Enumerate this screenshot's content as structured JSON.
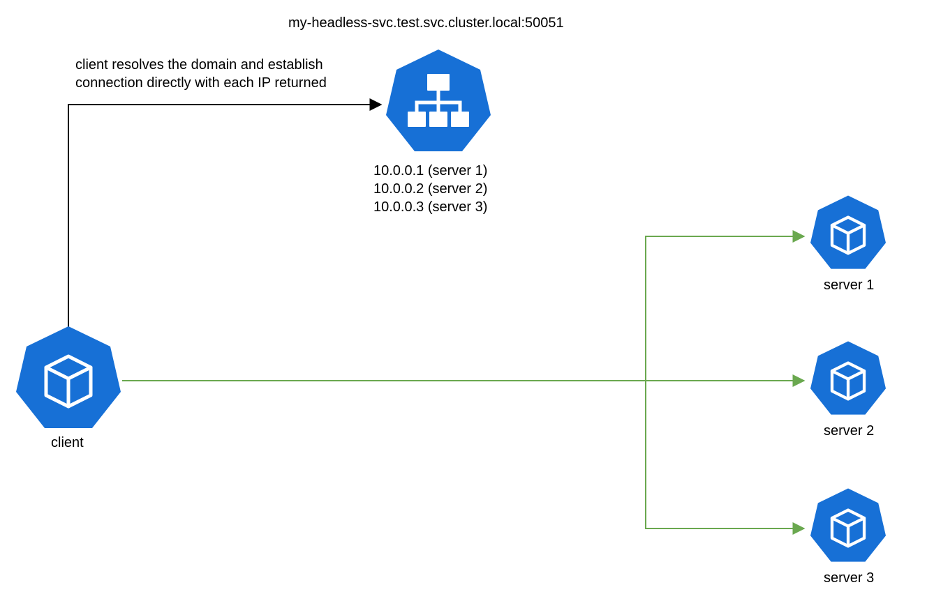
{
  "title": "my-headless-svc.test.svc.cluster.local:50051",
  "annotation": "client resolves the domain and establish\nconnection directly with each IP returned",
  "dns_results": [
    "10.0.0.1 (server 1)",
    "10.0.0.2 (server 2)",
    "10.0.0.3 (server 3)"
  ],
  "nodes": {
    "client": {
      "label": "client"
    },
    "server1": {
      "label": "server 1"
    },
    "server2": {
      "label": "server 2"
    },
    "server3": {
      "label": "server 3"
    }
  },
  "colors": {
    "k8s_blue": "#1770d6",
    "arrow_black": "#000000",
    "arrow_green": "#6aa84f"
  }
}
